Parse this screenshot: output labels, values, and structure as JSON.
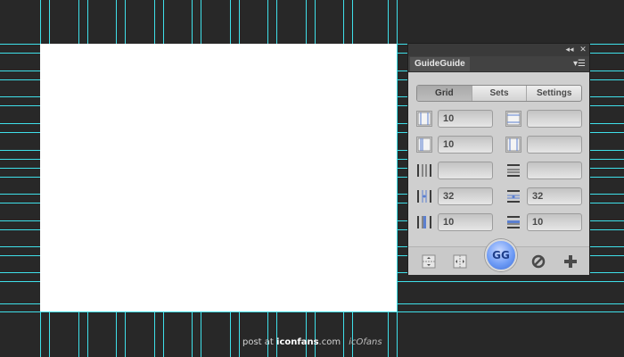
{
  "panel": {
    "title": "GuideGuide",
    "collapse_glyph": "◂◂",
    "close_glyph": "✕",
    "menu_glyph": "▾☰",
    "tabs": [
      "Grid",
      "Sets",
      "Settings"
    ],
    "active_tab": "Grid",
    "fields": [
      {
        "left_icon": "column-count-icon",
        "left_value": "10",
        "right_icon": "row-count-icon",
        "right_value": ""
      },
      {
        "left_icon": "column-width-icon",
        "left_value": "10",
        "right_icon": "row-height-icon",
        "right_value": ""
      },
      {
        "left_icon": "column-gutter-icon",
        "left_value": "",
        "right_icon": "row-gutter-icon",
        "right_value": ""
      },
      {
        "left_icon": "column-margin-icon",
        "left_value": "32",
        "right_icon": "row-margin-icon",
        "right_value": "32"
      },
      {
        "left_icon": "column-offset-icon",
        "left_value": "10",
        "right_icon": "row-offset-icon",
        "right_value": "10"
      }
    ],
    "footer": {
      "gg_label": "GG",
      "midpoint_horizontal_icon": "horizontal-midpoint-icon",
      "midpoint_vertical_icon": "vertical-midpoint-icon",
      "clear_icon": "clear-guides-icon",
      "add_icon": "add-guides-icon"
    }
  },
  "watermark": {
    "prefix": "post at",
    "site": "iconfans",
    "suffix": ".com",
    "logo": "icOfans"
  },
  "colors": {
    "background": "#282828",
    "guide": "#3fe0ea",
    "canvas": "#ffffff",
    "gg_button": "#6f9cf6"
  }
}
